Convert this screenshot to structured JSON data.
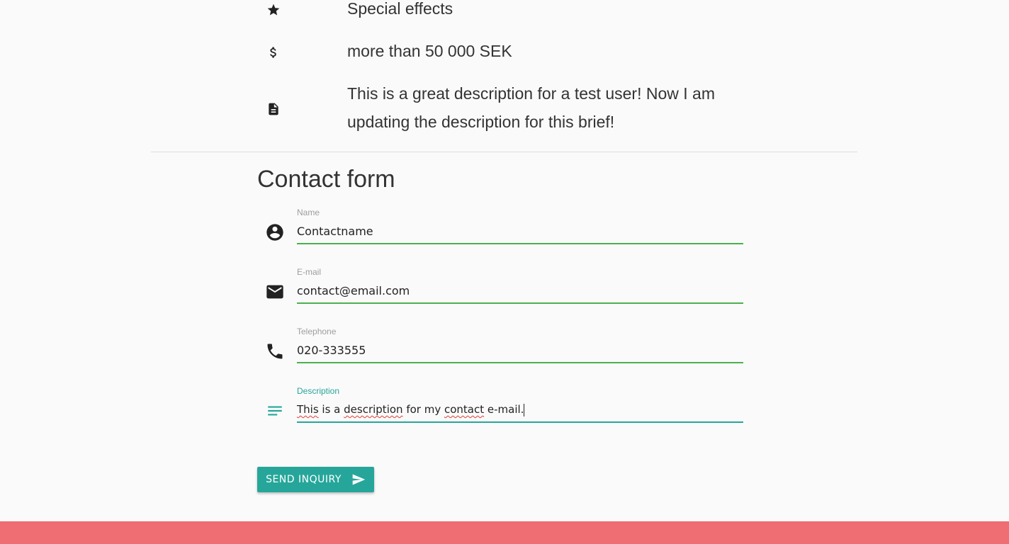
{
  "info": {
    "style": {
      "icon": "star-icon",
      "text": "Special effects"
    },
    "budget": {
      "icon": "dollar-icon",
      "text": "more than 50 000 SEK"
    },
    "description": {
      "icon": "document-icon",
      "text": "This is a great description for a test user! Now I am updating the description for this brief!"
    }
  },
  "contact_form": {
    "title": "Contact form",
    "fields": {
      "name": {
        "label": "Name",
        "value": "Contactname",
        "icon": "account-circle-icon"
      },
      "email": {
        "label": "E-mail",
        "value": "contact@email.com",
        "icon": "mail-icon"
      },
      "telephone": {
        "label": "Telephone",
        "value": "020-333555",
        "icon": "phone-icon"
      },
      "description": {
        "label": "Description",
        "icon": "notes-icon",
        "words": [
          "This",
          " is a ",
          "description",
          " for my ",
          "contact",
          " e-mail."
        ],
        "value": "This is a description for my contact e-mail."
      }
    },
    "send_label": "SEND INQUIRY",
    "send_icon": "send-icon"
  },
  "colors": {
    "accent": "#26a69a",
    "valid": "#4caf50",
    "footer": "#ee6e73"
  }
}
